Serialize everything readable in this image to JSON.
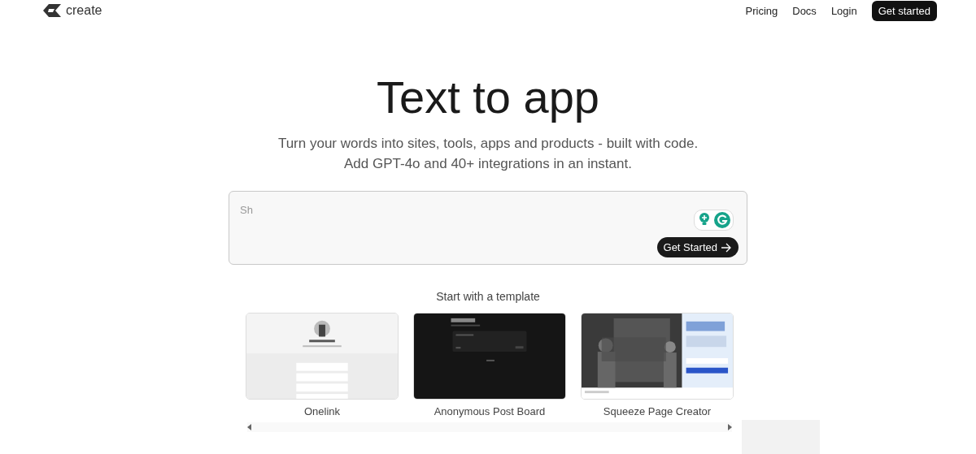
{
  "header": {
    "logo": "create",
    "nav": [
      {
        "label": "Pricing",
        "kind": "link"
      },
      {
        "label": "Docs",
        "kind": "link"
      },
      {
        "label": "Login",
        "kind": "link"
      },
      {
        "label": "Get started",
        "kind": "button"
      }
    ]
  },
  "hero": {
    "title": "Text to app",
    "subtitle": [
      "Turn your words into sites, tools, apps and products - built with code.",
      "Add GPT-4o and 40+ integrations in an instant."
    ]
  },
  "prompt": {
    "placeholder": "Sh",
    "button": "Get Started"
  },
  "templates": {
    "heading": "Start with a template",
    "items": [
      {
        "label": "Onelink",
        "kind": "picture"
      },
      {
        "label": "Anonymous Post Board",
        "kind": "picture"
      },
      {
        "label": "Squeeze Page Creator",
        "kind": "picture"
      }
    ]
  }
}
